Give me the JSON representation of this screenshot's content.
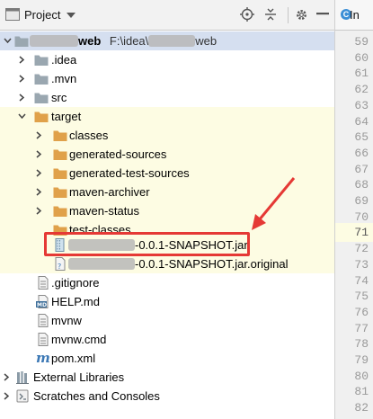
{
  "toolbar": {
    "title": "Project",
    "icons": [
      "project-view-icon",
      "target-icon",
      "collapse-icon",
      "settings-icon",
      "hide-icon"
    ]
  },
  "editor_tab": {
    "label": "In",
    "icon": "class-icon"
  },
  "tree": {
    "root": {
      "name_visible": "web",
      "path_prefix": "F:\\idea\\",
      "path_suffix": "web"
    },
    "items": [
      {
        "label": ".idea",
        "icon": "folder-icon"
      },
      {
        "label": ".mvn",
        "icon": "folder-icon"
      },
      {
        "label": "src",
        "icon": "folder-icon"
      },
      {
        "label": "target",
        "icon": "folder-orange-icon"
      },
      {
        "label": "classes",
        "icon": "folder-orange-icon"
      },
      {
        "label": "generated-sources",
        "icon": "folder-orange-icon"
      },
      {
        "label": "generated-test-sources",
        "icon": "folder-orange-icon"
      },
      {
        "label": "maven-archiver",
        "icon": "folder-orange-icon"
      },
      {
        "label": "maven-status",
        "icon": "folder-orange-icon"
      },
      {
        "label": "test-classes",
        "icon": "folder-orange-icon"
      },
      {
        "label": "-0.0.1-SNAPSHOT.jar",
        "icon": "jar-icon"
      },
      {
        "label": "-0.0.1-SNAPSHOT.jar.original",
        "icon": "unknown-file-icon"
      },
      {
        "label": ".gitignore",
        "icon": "text-file-icon"
      },
      {
        "label": "HELP.md",
        "icon": "markdown-icon"
      },
      {
        "label": "mvnw",
        "icon": "text-file-icon"
      },
      {
        "label": "mvnw.cmd",
        "icon": "text-file-icon"
      },
      {
        "label": "pom.xml",
        "icon": "maven-icon"
      },
      {
        "label": "External Libraries",
        "icon": "libraries-icon"
      },
      {
        "label": "Scratches and Consoles",
        "icon": "scratches-icon"
      }
    ]
  },
  "gutter": {
    "line_numbers": [
      "59",
      "60",
      "61",
      "62",
      "63",
      "64",
      "65",
      "66",
      "67",
      "68",
      "69",
      "70",
      "71",
      "72",
      "73",
      "74",
      "75",
      "76",
      "77",
      "78",
      "79",
      "80",
      "81",
      "82"
    ],
    "current_line": "71"
  },
  "colors": {
    "highlight_row": "#fdfce3",
    "folder_orange": "#e0a14a",
    "folder_grey": "#9aa7b0",
    "annotation_red": "#e53935"
  }
}
